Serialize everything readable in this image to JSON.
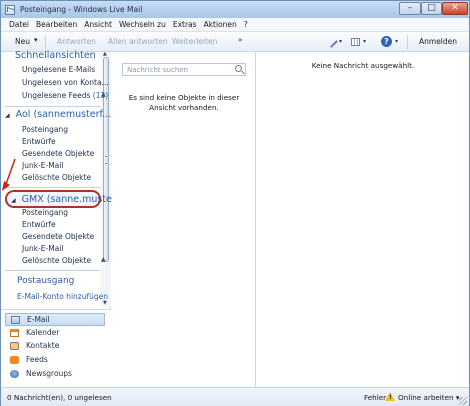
{
  "window": {
    "title": "Posteingang - Windows Live Mail",
    "min_glyph": "–",
    "max_glyph": "□",
    "close_glyph": "✕"
  },
  "menu": [
    "Datei",
    "Bearbeiten",
    "Ansicht",
    "Wechseln zu",
    "Extras",
    "Aktionen",
    "?"
  ],
  "toolbar": {
    "new": "Neu",
    "new_chevron": "▾",
    "reply": "Antworten",
    "reply_all": "Allen antworten",
    "forward": "Weiterleiten",
    "more_chevron": "»",
    "help_glyph": "?",
    "dropdown_glyph": "▾",
    "signin": "Anmelden"
  },
  "sidebar": {
    "scroll_up": "▲",
    "scroll_down": "▼",
    "collapse_glyph": "◢",
    "section_chevron": "▲",
    "quick_views": {
      "title": "Schnellansichten",
      "items": [
        {
          "label": "Ungelesene E-Mails",
          "count": ""
        },
        {
          "label": "Ungelesen von Konta...",
          "count": ""
        },
        {
          "label": "Ungelesene Feeds",
          "count": "(13)"
        }
      ]
    },
    "aol": {
      "title": "Aol (sannemusterf...",
      "items": [
        "Posteingang",
        "Entwürfe",
        "Gesendete Objekte",
        "Junk-E-Mail",
        "Gelöschte Objekte"
      ]
    },
    "gmx": {
      "title": "GMX (sanne.muste...",
      "items": [
        "Posteingang",
        "Entwürfe",
        "Gesendete Objekte",
        "Junk-E-Mail",
        "Gelöschte Objekte"
      ]
    },
    "outbox": "Postausgang",
    "add_account": "E-Mail-Konto hinzufügen",
    "bottom_nav": [
      "E-Mail",
      "Kalender",
      "Kontakte",
      "Feeds",
      "Newsgroups"
    ]
  },
  "list": {
    "search_placeholder": "Nachricht suchen",
    "empty_message": "Es sind keine Objekte in dieser Ansicht vorhanden."
  },
  "preview": {
    "empty_message": "Keine Nachricht ausgewählt."
  },
  "status": {
    "counts": "0 Nachricht(en), 0 ungelesen",
    "errors": "Fehler",
    "warning_glyph": "!",
    "online": "Online arbeiten",
    "online_chevron": "▾"
  },
  "colors": {
    "accent_blue": "#2a5ea8",
    "highlight_red": "#a7352e",
    "warning_yellow": "#f2c01e"
  }
}
